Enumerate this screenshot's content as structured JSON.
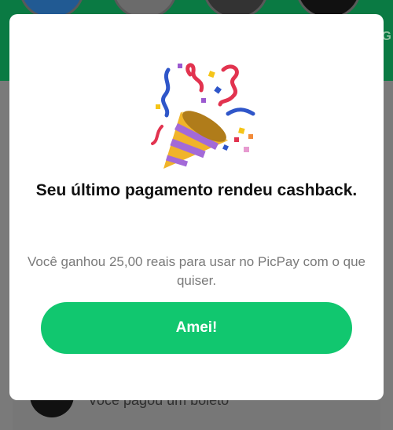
{
  "background": {
    "edge_letter": "G",
    "row_text": "Você pagou um boleto"
  },
  "modal": {
    "icon": "party-popper-icon",
    "title": "Seu último pagamento rendeu cashback.",
    "message": "Você ganhou 25,00 reais para usar no PicPay com o que quiser.",
    "button_label": "Amei!"
  },
  "colors": {
    "accent": "#11C76F",
    "header_bg": "#0A7A43"
  }
}
